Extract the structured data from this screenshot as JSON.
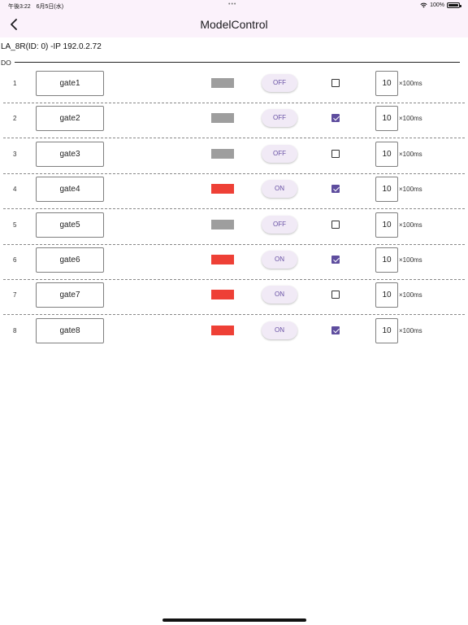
{
  "status_bar": {
    "time": "午後3:22",
    "date": "6月5日(水)",
    "multitask": "•••",
    "battery": "100%"
  },
  "header": {
    "title": "ModelControl",
    "back_icon": "chevron-left-icon"
  },
  "device": {
    "title": "LA_8R(ID: 0) -IP 192.0.2.72"
  },
  "section": {
    "label": "DO"
  },
  "colors": {
    "on_indicator": "#ee4036",
    "off_indicator": "#9e9e9e",
    "accent": "#5e4d9e",
    "header_bg": "#fbf2fb"
  },
  "rows": [
    {
      "number": "1",
      "name": "gate1",
      "state": "OFF",
      "checked": false,
      "interval": "10",
      "unit": "×100ms"
    },
    {
      "number": "2",
      "name": "gate2",
      "state": "OFF",
      "checked": true,
      "interval": "10",
      "unit": "×100ms"
    },
    {
      "number": "3",
      "name": "gate3",
      "state": "OFF",
      "checked": false,
      "interval": "10",
      "unit": "×100ms"
    },
    {
      "number": "4",
      "name": "gate4",
      "state": "ON",
      "checked": true,
      "interval": "10",
      "unit": "×100ms"
    },
    {
      "number": "5",
      "name": "gate5",
      "state": "OFF",
      "checked": false,
      "interval": "10",
      "unit": "×100ms"
    },
    {
      "number": "6",
      "name": "gate6",
      "state": "ON",
      "checked": true,
      "interval": "10",
      "unit": "×100ms"
    },
    {
      "number": "7",
      "name": "gate7",
      "state": "ON",
      "checked": false,
      "interval": "10",
      "unit": "×100ms"
    },
    {
      "number": "8",
      "name": "gate8",
      "state": "ON",
      "checked": true,
      "interval": "10",
      "unit": "×100ms"
    }
  ]
}
